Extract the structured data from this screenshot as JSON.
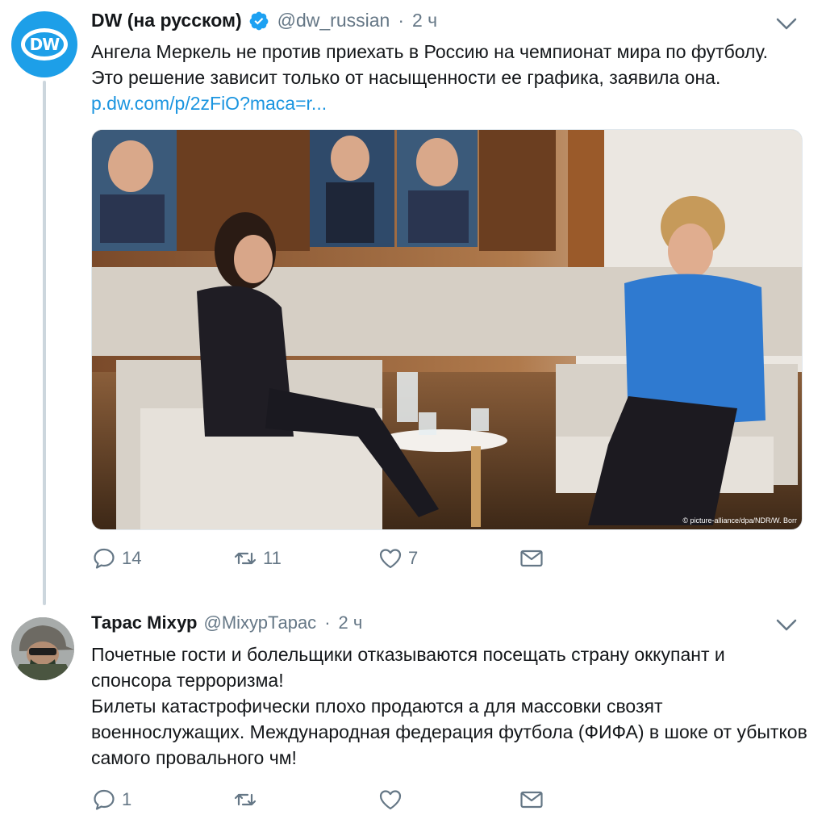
{
  "tweets": [
    {
      "author_name": "DW (на русском)",
      "handle": "@dw_russian",
      "separator": "·",
      "time": "2 ч",
      "verified": true,
      "text": "Ангела Меркель не против приехать в Россию на чемпионат мира по футболу. Это решение зависит только от насыщенности ее графика, заявила она. ",
      "link": "p.dw.com/p/2zFiO?maca=r...",
      "avatar_text": "DW",
      "photo_credit": "© picture-alliance/dpa/NDR/W. Borr",
      "replies": "14",
      "retweets": "11",
      "likes": "7"
    },
    {
      "author_name": "Тарас Міхур",
      "handle": "@МіхурТарас",
      "separator": "·",
      "time": "2 ч",
      "text_line1": "Почетные гости и болельщики отказываются посещать страну оккупант и спонсора терроризма!",
      "text_line2": "Билеты катастрофически плохо продаются а для массовки свозят военнослужащих. Международная федерация футбола (ФИФА) в шоке от убытков самого провального чм!",
      "replies": "1",
      "retweets": "",
      "likes": ""
    }
  ],
  "colors": {
    "accent": "#1b95e0",
    "muted": "#657786",
    "thread_line": "#ccd6dd"
  },
  "icons": [
    "verified-icon",
    "chevron-down-icon",
    "reply-icon",
    "retweet-icon",
    "like-icon",
    "message-icon"
  ]
}
